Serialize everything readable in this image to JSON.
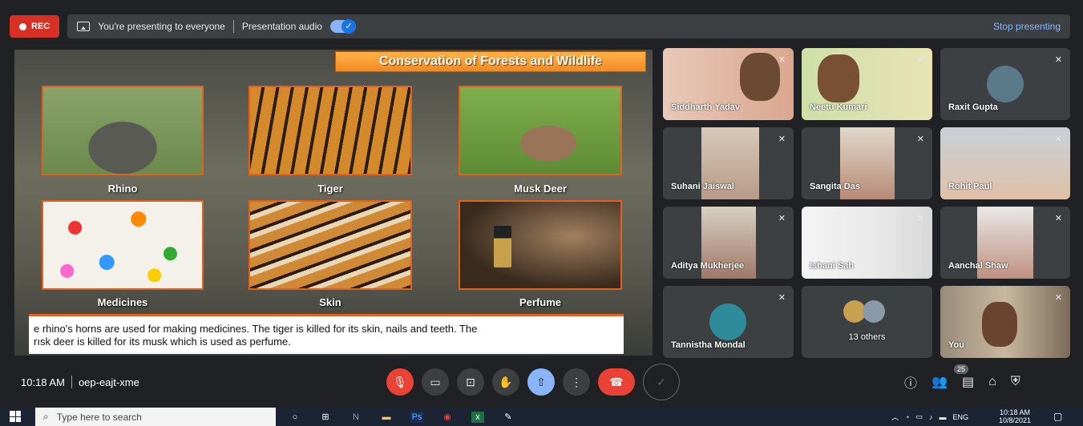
{
  "topbar": {
    "rec_label": "REC",
    "presenting_text": "You're presenting to everyone",
    "audio_label": "Presentation audio",
    "stop_label": "Stop presenting"
  },
  "slide": {
    "title": "Conservation of Forests and Wildlife",
    "captions": [
      "Rhino",
      "Tiger",
      "Musk Deer",
      "Medicines",
      "Skin",
      "Perfume"
    ],
    "text_line1": "e rhino's horns are used for making medicines. The tiger is killed for its skin, nails and teeth. The",
    "text_line2": "rısk deer is killed for its musk which is used as perfume."
  },
  "participants": [
    {
      "name": "Siddharth Yadav"
    },
    {
      "name": "Neetu Kumari"
    },
    {
      "name": "Raxit Gupta"
    },
    {
      "name": "Suhani Jaiswal"
    },
    {
      "name": "Sangita Das"
    },
    {
      "name": "Rohit Paul"
    },
    {
      "name": "Aditya Mukherjee"
    },
    {
      "name": "Ishani Sah"
    },
    {
      "name": "Aanchal Shaw"
    },
    {
      "name": "Tannistha Mondal"
    },
    {
      "name": "13 others"
    },
    {
      "name": "You"
    }
  ],
  "bottom": {
    "time": "10:18 AM",
    "meeting_code": "oep-eajt-xme",
    "participant_count": "25"
  },
  "taskbar": {
    "search_placeholder": "Type here to search",
    "lang": "ENG",
    "time": "10:18 AM",
    "date": "10/8/2021"
  }
}
